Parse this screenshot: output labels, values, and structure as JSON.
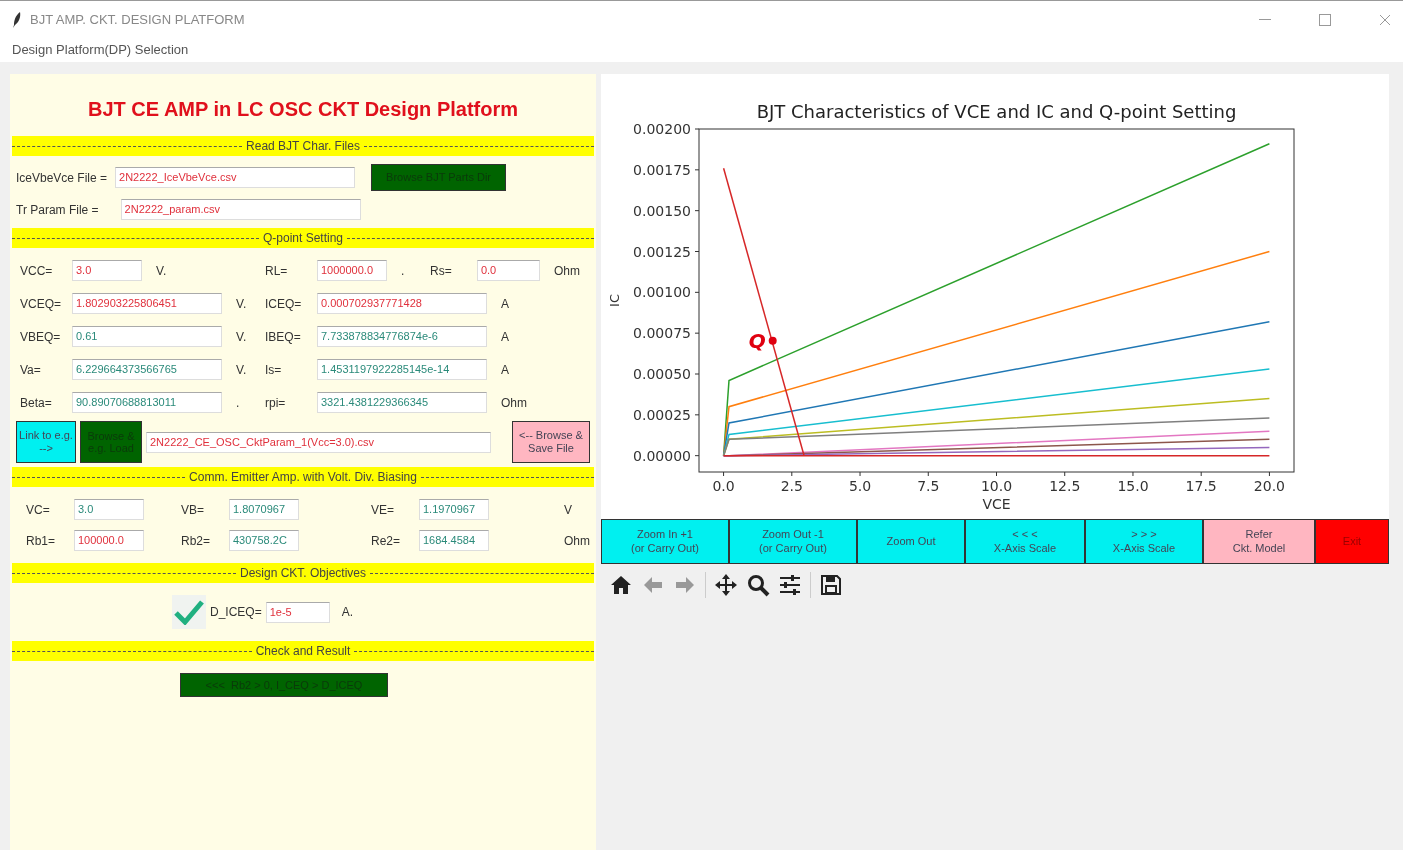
{
  "window": {
    "title": "BJT AMP. CKT. DESIGN PLATFORM"
  },
  "menu": [
    "Design Platform(DP) Selection"
  ],
  "left": {
    "title": "BJT CE AMP in LC OSC CKT Design Platform",
    "sections": [
      {
        "heading": "Read BJT Char. Files",
        "kind": "files",
        "rows": [
          {
            "label": "IceVbeVce File =",
            "value": "2N2222_IceVbeVce.csv",
            "button": "Browse BJT Parts Dir"
          },
          {
            "label": "Tr Param File =",
            "value": "2N2222_param.csv"
          }
        ]
      },
      {
        "heading": "Q-point Setting",
        "kind": "grid",
        "rows": [
          [
            {
              "label": "VCC=",
              "value": "3.0",
              "kind": "input",
              "unit": "V."
            },
            {
              "label": "RL=",
              "value": "1000000.0",
              "kind": "input",
              "unit": "."
            },
            {
              "label": "Rs=",
              "value": "0.0",
              "kind": "input",
              "unit": "Ohm"
            }
          ],
          [
            {
              "label": "VCEQ=",
              "value": "1.802903225806451",
              "kind": "input",
              "unit": "V."
            },
            {
              "label": "ICEQ=",
              "value": "0.000702937771428",
              "kind": "input",
              "unit": "A"
            }
          ],
          [
            {
              "label": "VBEQ=",
              "value": "0.61",
              "kind": "output",
              "unit": "V."
            },
            {
              "label": "IBEQ=",
              "value": "7.733878834776874e-6",
              "kind": "output",
              "unit": "A"
            }
          ],
          [
            {
              "label": "Va=",
              "value": "6.229664373566765",
              "kind": "output",
              "unit": "V."
            },
            {
              "label": "Is=",
              "value": "1.4531197922285145e-14",
              "kind": "output",
              "unit": "A"
            }
          ],
          [
            {
              "label": "Beta=",
              "value": "90.89070688813011",
              "kind": "output",
              "unit": "."
            },
            {
              "label": "rpi=",
              "value": "3321.4381229366345",
              "kind": "output",
              "unit": "Ohm"
            }
          ]
        ],
        "file_bar": {
          "link": "Link to e.g. -->",
          "browse": "Browse & e.g. Load",
          "value": "2N2222_CE_OSC_CktParam_1(Vcc=3.0).csv",
          "save": "<-- Browse & Save File"
        }
      },
      {
        "heading": "Comm. Emitter Amp. with Volt. Div. Biasing",
        "kind": "grid",
        "rows": [
          [
            {
              "label": "VC=",
              "value": "3.0",
              "kind": "output"
            },
            {
              "label": "VB=",
              "value": "1.8070967",
              "kind": "output"
            },
            {
              "label": "VE=",
              "value": "1.1970967",
              "kind": "output"
            },
            {
              "unit": "V"
            }
          ],
          [
            {
              "label": "Rb1=",
              "value": "100000.0",
              "kind": "input"
            },
            {
              "label": "Rb2=",
              "value": "430758.2C",
              "kind": "output"
            },
            {
              "label": "Re2=",
              "value": "1684.4584",
              "kind": "output"
            },
            {
              "unit": "Ohm"
            }
          ]
        ]
      },
      {
        "heading": "Design CKT. Objectives",
        "kind": "objective",
        "checked": true,
        "label": "D_ICEQ=",
        "value": "1e-5",
        "unit": "A."
      },
      {
        "heading": "Check and Result",
        "kind": "result",
        "result": "<<<  Rb2 > 0, I_CEQ > D_ICEQ"
      }
    ]
  },
  "plot": {
    "chart_data": {
      "type": "line",
      "title": "BJT Characteristics of VCE and IC and Q-point Setting",
      "xlabel": "VCE",
      "ylabel": "IC",
      "x": [
        0,
        0.2,
        20
      ],
      "xlim": [
        -0.9,
        20.9
      ],
      "ylim": [
        -0.0001,
        0.002
      ],
      "xticks": [
        {
          "value": 0,
          "label": "0.0"
        },
        {
          "value": 2.5,
          "label": "2.5"
        },
        {
          "value": 5,
          "label": "5.0"
        },
        {
          "value": 7.5,
          "label": "7.5"
        },
        {
          "value": 10,
          "label": "10.0"
        },
        {
          "value": 12.5,
          "label": "12.5"
        },
        {
          "value": 15,
          "label": "15.0"
        },
        {
          "value": 17.5,
          "label": "17.5"
        },
        {
          "value": 20,
          "label": "20.0"
        }
      ],
      "yticks": [
        {
          "value": 0,
          "label": "0.00000"
        },
        {
          "value": 0.00025,
          "label": "0.00025"
        },
        {
          "value": 0.0005,
          "label": "0.00050"
        },
        {
          "value": 0.00075,
          "label": "0.00075"
        },
        {
          "value": 0.001,
          "label": "0.00100"
        },
        {
          "value": 0.00125,
          "label": "0.00125"
        },
        {
          "value": 0.0015,
          "label": "0.00150"
        },
        {
          "value": 0.00175,
          "label": "0.00175"
        },
        {
          "value": 0.002,
          "label": "0.00200"
        }
      ],
      "series": [
        {
          "color": "#2ca02c",
          "values": [
            0,
            0.00046,
            0.00191
          ]
        },
        {
          "color": "#ff7f0e",
          "values": [
            0,
            0.0003,
            0.00125
          ]
        },
        {
          "color": "#1f77b4",
          "values": [
            0,
            0.0002,
            0.00082
          ]
        },
        {
          "color": "#17becf",
          "values": [
            0,
            0.00013,
            0.00053
          ]
        },
        {
          "color": "#bcbd22",
          "values": [
            0,
            0.0001,
            0.00035
          ]
        },
        {
          "color": "#7f7f7f",
          "values": [
            0,
            0.0001,
            0.00023
          ]
        },
        {
          "color": "#e377c2",
          "values": [
            0,
            0,
            0.00015
          ]
        },
        {
          "color": "#8c564b",
          "values": [
            0,
            0,
            0.0001
          ]
        },
        {
          "color": "#9467bd",
          "values": [
            0,
            0,
            5e-05
          ]
        },
        {
          "color": "#d62728",
          "values": [
            0,
            0,
            0
          ]
        },
        {
          "color": "#d62728",
          "x": [
            0,
            2.95
          ],
          "values": [
            0.00176,
            0
          ]
        }
      ],
      "annotations": [
        {
          "text": "Q",
          "x": 1.8,
          "y": 0.000703
        }
      ]
    },
    "buttons": [
      {
        "label": "Zoom In +1\n(or Carry Out)",
        "kind": "cyan"
      },
      {
        "label": "Zoom Out -1\n(or Carry Out)",
        "kind": "cyan"
      },
      {
        "label": "Zoom Out",
        "kind": "cyan"
      },
      {
        "label": "< < <\nX-Axis Scale",
        "kind": "cyan"
      },
      {
        "label": "> > >\nX-Axis Scale",
        "kind": "cyan"
      },
      {
        "label": "Refer\nCkt. Model",
        "kind": "pink"
      },
      {
        "label": "Exit",
        "kind": "red"
      }
    ]
  }
}
